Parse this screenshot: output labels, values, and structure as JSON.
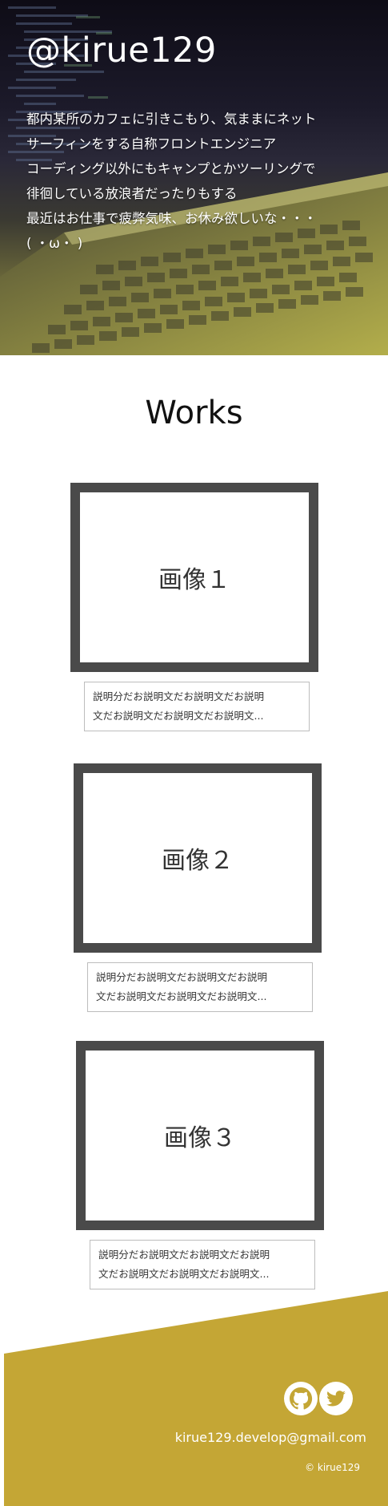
{
  "hero": {
    "title": "@kirue129",
    "lines": [
      "都内某所のカフェに引きこもり、気ままにネット",
      "サーフィンをする自称フロントエンジニア",
      "コーディング以外にもキャンプとかツーリングで",
      "徘徊している放浪者だったりもする",
      "最近はお仕事で疲弊気味、お休み欲しいな・・・",
      "( ・ω・ )"
    ]
  },
  "works": {
    "title": "Works",
    "items": [
      {
        "image_label": "画像１",
        "desc_line1": "説明分だお説明文だお説明文だお説明",
        "desc_line2": "文だお説明文だお説明文だお説明文..."
      },
      {
        "image_label": "画像２",
        "desc_line1": "説明分だお説明文だお説明文だお説明",
        "desc_line2": "文だお説明文だお説明文だお説明文..."
      },
      {
        "image_label": "画像３",
        "desc_line1": "説明分だお説明文だお説明文だお説明",
        "desc_line2": "文だお説明文だお説明文だお説明文..."
      }
    ]
  },
  "footer": {
    "icons": [
      "github-icon",
      "twitter-icon"
    ],
    "email": "kirue129.develop@gmail.com",
    "copyright": "© kirue129",
    "bg_color": "#c4a635"
  }
}
